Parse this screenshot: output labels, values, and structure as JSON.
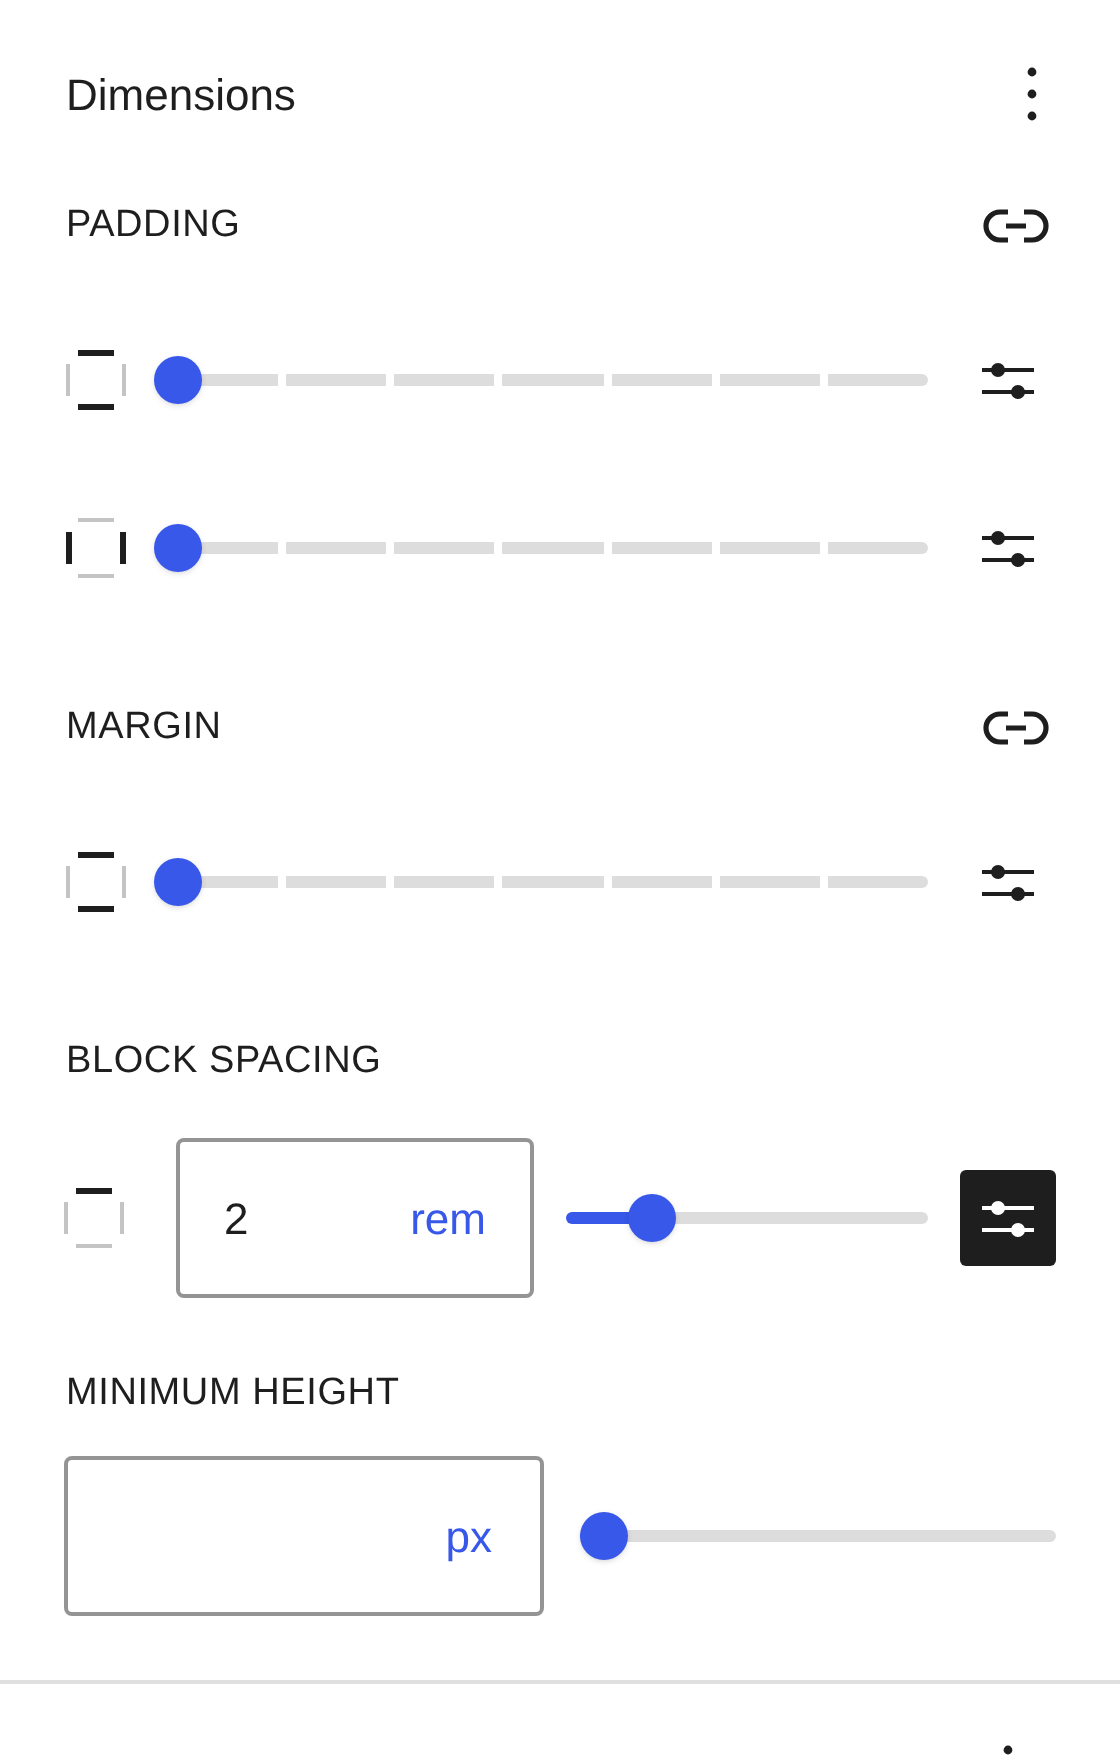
{
  "panel": {
    "title": "Dimensions"
  },
  "sections": [
    {
      "label": "PADDING",
      "kind": "sides",
      "rows": [
        {
          "kind": "stepped",
          "sides": {
            "top": true,
            "bottom": true,
            "left": false,
            "right": false
          },
          "level": 0,
          "custom_on": false
        },
        {
          "kind": "stepped",
          "sides": {
            "top": false,
            "bottom": false,
            "left": true,
            "right": true
          },
          "level": 0,
          "custom_on": false
        }
      ]
    },
    {
      "label": "MARGIN",
      "kind": "sides",
      "rows": [
        {
          "kind": "stepped",
          "sides": {
            "top": true,
            "bottom": true,
            "left": false,
            "right": false
          },
          "level": 0,
          "custom_on": false
        }
      ]
    },
    {
      "label": "BLOCK SPACING",
      "kind": "single",
      "rows": [
        {
          "kind": "input_slider",
          "sides": {
            "top": true,
            "bottom": false,
            "left": false,
            "right": false
          },
          "value": "2",
          "unit": "rem",
          "level": 0.2,
          "custom_on": true
        }
      ]
    },
    {
      "label": "MINIMUM HEIGHT",
      "kind": "single",
      "rows": [
        {
          "kind": "input_slider",
          "unit": "px",
          "level": 0
        }
      ]
    }
  ]
}
